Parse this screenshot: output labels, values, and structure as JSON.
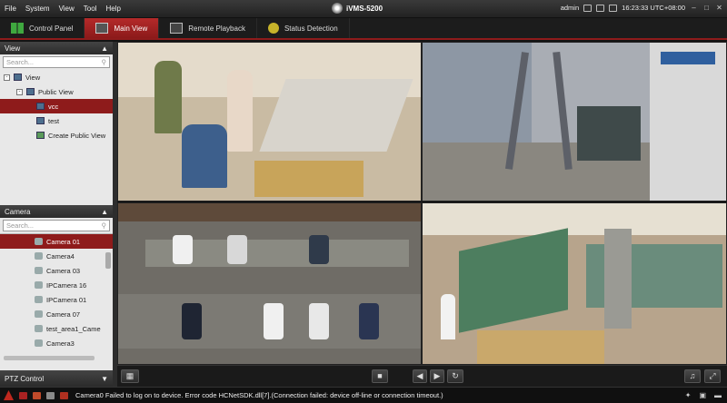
{
  "menu": [
    "File",
    "System",
    "View",
    "Tool",
    "Help"
  ],
  "app_title": "iVMS-5200",
  "user": "admin",
  "clock": "16:23:33 UTC+08:00",
  "tabs": [
    {
      "label": "Control Panel",
      "icon": "control-panel-icon"
    },
    {
      "label": "Main View",
      "icon": "monitor-icon",
      "active": true
    },
    {
      "label": "Remote Playback",
      "icon": "playback-icon"
    },
    {
      "label": "Status Detection",
      "icon": "status-icon"
    }
  ],
  "view_panel": {
    "header": "View",
    "search_placeholder": "Search...",
    "tree": [
      {
        "label": "View",
        "level": 0
      },
      {
        "label": "Public View",
        "level": 1
      },
      {
        "label": "vcc",
        "level": 2,
        "selected": true
      },
      {
        "label": "test",
        "level": 2
      },
      {
        "label": "Create Public View",
        "level": 2
      }
    ]
  },
  "camera_panel": {
    "header": "Camera",
    "search_placeholder": "Search...",
    "cameras": [
      {
        "label": "Camera 01",
        "selected": true
      },
      {
        "label": "Camera4"
      },
      {
        "label": "Camera 03"
      },
      {
        "label": "IPCamera 16"
      },
      {
        "label": "IPCamera 01"
      },
      {
        "label": "Camera 07"
      },
      {
        "label": "test_area1_Came"
      },
      {
        "label": "Camera3"
      }
    ]
  },
  "ptz_panel": {
    "header": "PTZ Control"
  },
  "feeds": [
    {
      "scene": "checkout-counter"
    },
    {
      "scene": "bank-entrance"
    },
    {
      "scene": "parking-lot"
    },
    {
      "scene": "supermarket-aisle"
    }
  ],
  "status": {
    "message": "Camera0 Failed to log on to device. Error code HCNetSDK.dll[7].(Connection failed: device off-line or connection timeout.)"
  },
  "colors": {
    "accent": "#8e1b1b",
    "selection": "#b02525"
  }
}
